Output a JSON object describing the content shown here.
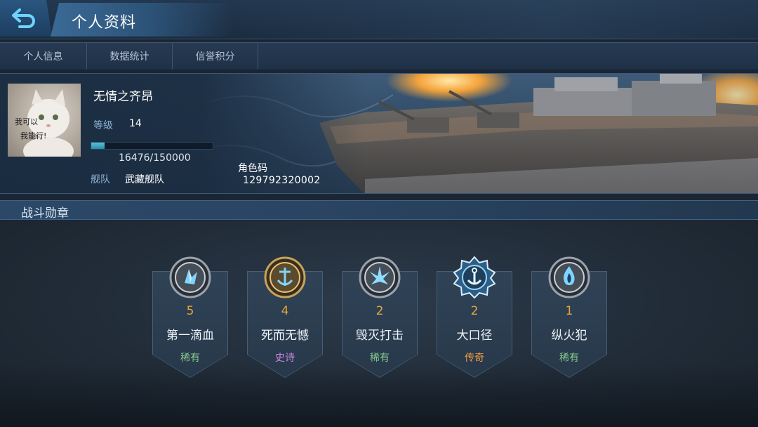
{
  "header": {
    "title": "个人资料"
  },
  "tabs": [
    {
      "label": "个人信息"
    },
    {
      "label": "数据统计"
    },
    {
      "label": "信誉积分"
    }
  ],
  "profile": {
    "name": "无情之齐昂",
    "avatar_text_line1": "我可以",
    "avatar_text_line2": "我能行!",
    "level_label": "等级",
    "level_value": "14",
    "xp_text": "16476/150000",
    "xp_fraction": 0.11,
    "fleet_label": "舰队",
    "fleet_value": "武藏舰队",
    "role_code_label": "角色码",
    "role_code_value": "129792320002"
  },
  "medals_section": {
    "title": "战斗勋章"
  },
  "medals": [
    {
      "count": "5",
      "name": "第一滴血",
      "rarity": "稀有",
      "rarity_color": "#86c98d",
      "icon": "silver-crystal-medal-icon"
    },
    {
      "count": "4",
      "name": "死而无憾",
      "rarity": "史诗",
      "rarity_color": "#c985e0",
      "icon": "gold-anchor-medal-icon"
    },
    {
      "count": "2",
      "name": "毁灭打击",
      "rarity": "稀有",
      "rarity_color": "#86c98d",
      "icon": "silver-burst-medal-icon"
    },
    {
      "count": "2",
      "name": "大口径",
      "rarity": "传奇",
      "rarity_color": "#ef9a3f",
      "icon": "blue-anchor-medal-icon"
    },
    {
      "count": "1",
      "name": "纵火犯",
      "rarity": "稀有",
      "rarity_color": "#86c98d",
      "icon": "silver-flame-medal-icon"
    }
  ],
  "colors": {
    "accent": "#2c8ea8",
    "medal_count": "#e8a33a"
  }
}
